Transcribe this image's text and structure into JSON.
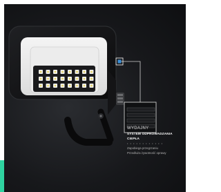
{
  "caption": {
    "title": "WYDAJNY",
    "subtitle": "SYSTEM ODPROWADZANIA CIEPŁA",
    "dots": "• • • • • • • • • • • •",
    "lines": [
      "Zapobiega przegrzaniu",
      "Przedłuża żywotność oprawy"
    ]
  },
  "colors": {
    "accent": "#2fd3a0",
    "marker": "#3a8fd8"
  }
}
